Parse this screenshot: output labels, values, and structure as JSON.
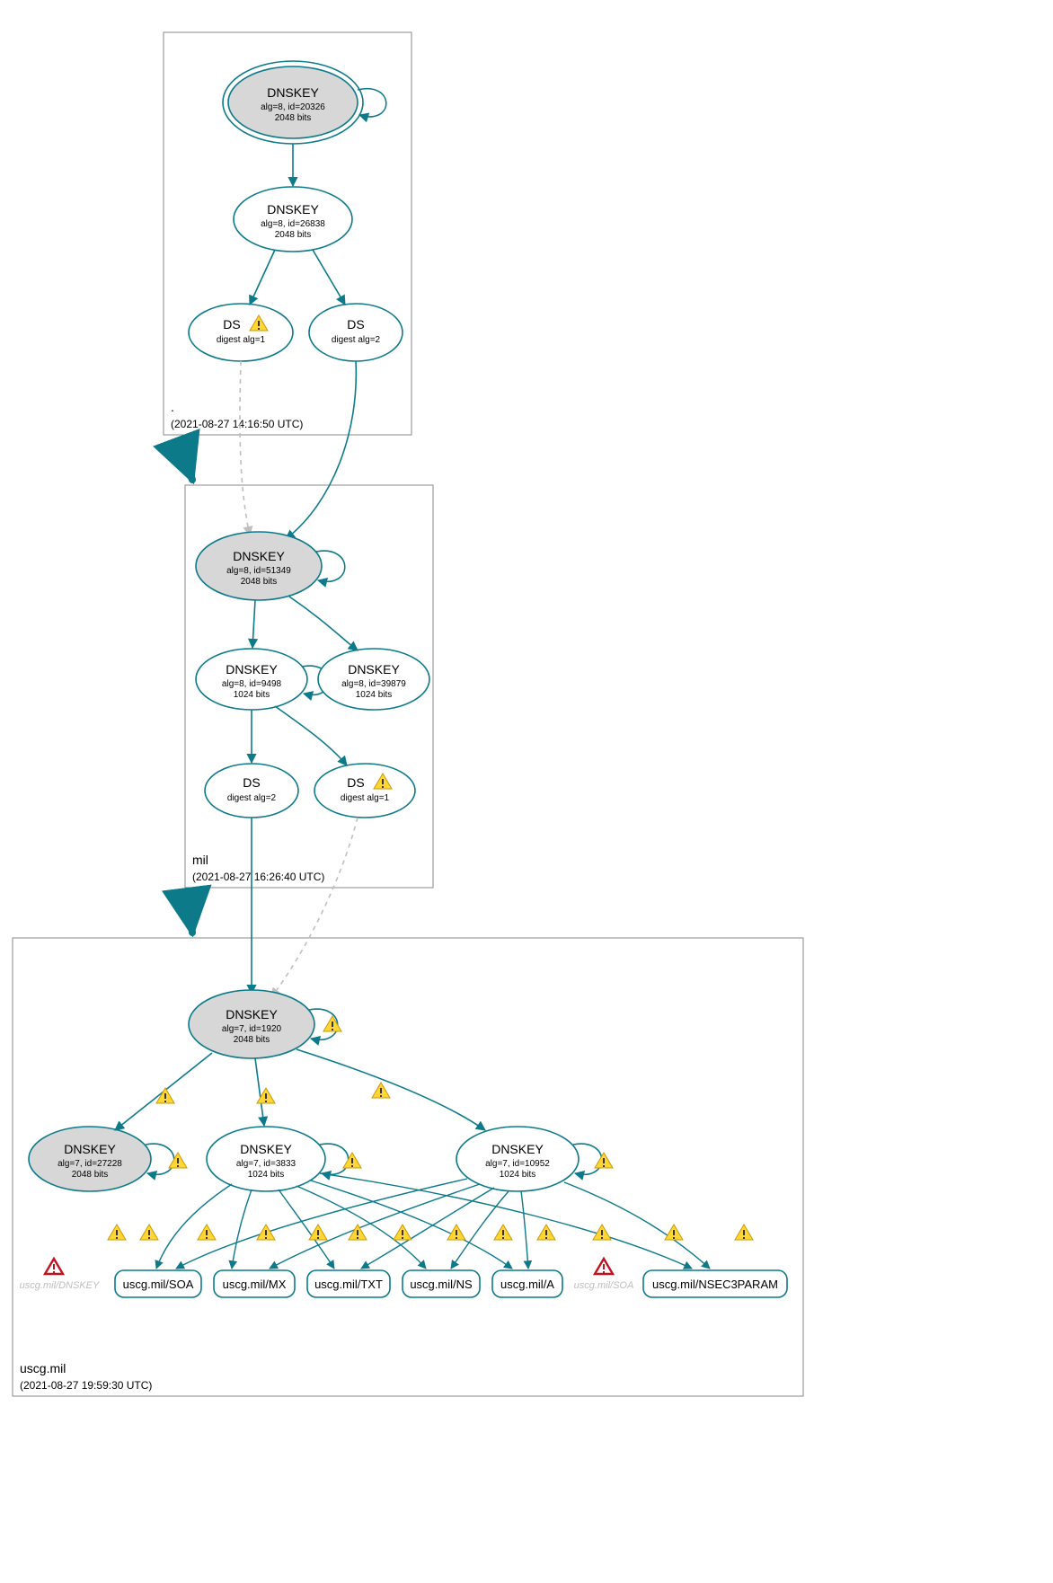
{
  "colors": {
    "stroke": "#0d7a8a",
    "fill_sep": "#d7d7d7",
    "box": "#8a8a8a",
    "dashed": "#bfbfbf"
  },
  "zones": {
    "root": {
      "label": ".",
      "timestamp": "(2021-08-27 14:16:50 UTC)"
    },
    "mil": {
      "label": "mil",
      "timestamp": "(2021-08-27 16:26:40 UTC)"
    },
    "uscg": {
      "label": "uscg.mil",
      "timestamp": "(2021-08-27 19:59:30 UTC)"
    }
  },
  "nodes": {
    "root_ksk": {
      "title": "DNSKEY",
      "l1": "alg=8, id=20326",
      "l2": "2048 bits"
    },
    "root_zsk": {
      "title": "DNSKEY",
      "l1": "alg=8, id=26838",
      "l2": "2048 bits"
    },
    "root_ds1": {
      "title": "DS",
      "l1": "digest alg=1"
    },
    "root_ds2": {
      "title": "DS",
      "l1": "digest alg=2"
    },
    "mil_ksk": {
      "title": "DNSKEY",
      "l1": "alg=8, id=51349",
      "l2": "2048 bits"
    },
    "mil_zsk1": {
      "title": "DNSKEY",
      "l1": "alg=8, id=9498",
      "l2": "1024 bits"
    },
    "mil_zsk2": {
      "title": "DNSKEY",
      "l1": "alg=8, id=39879",
      "l2": "1024 bits"
    },
    "mil_ds2": {
      "title": "DS",
      "l1": "digest alg=2"
    },
    "mil_ds1": {
      "title": "DS",
      "l1": "digest alg=1"
    },
    "u_ksk": {
      "title": "DNSKEY",
      "l1": "alg=7, id=1920",
      "l2": "2048 bits"
    },
    "u_k2": {
      "title": "DNSKEY",
      "l1": "alg=7, id=27228",
      "l2": "2048 bits"
    },
    "u_z1": {
      "title": "DNSKEY",
      "l1": "alg=7, id=3833",
      "l2": "1024 bits"
    },
    "u_z2": {
      "title": "DNSKEY",
      "l1": "alg=7, id=10952",
      "l2": "1024 bits"
    }
  },
  "rr": {
    "soa": "uscg.mil/SOA",
    "mx": "uscg.mil/MX",
    "txt": "uscg.mil/TXT",
    "ns": "uscg.mil/NS",
    "a": "uscg.mil/A",
    "nsec3": "uscg.mil/NSEC3PARAM"
  },
  "faded": {
    "dnskey": "uscg.mil/DNSKEY",
    "soa": "uscg.mil/SOA"
  }
}
